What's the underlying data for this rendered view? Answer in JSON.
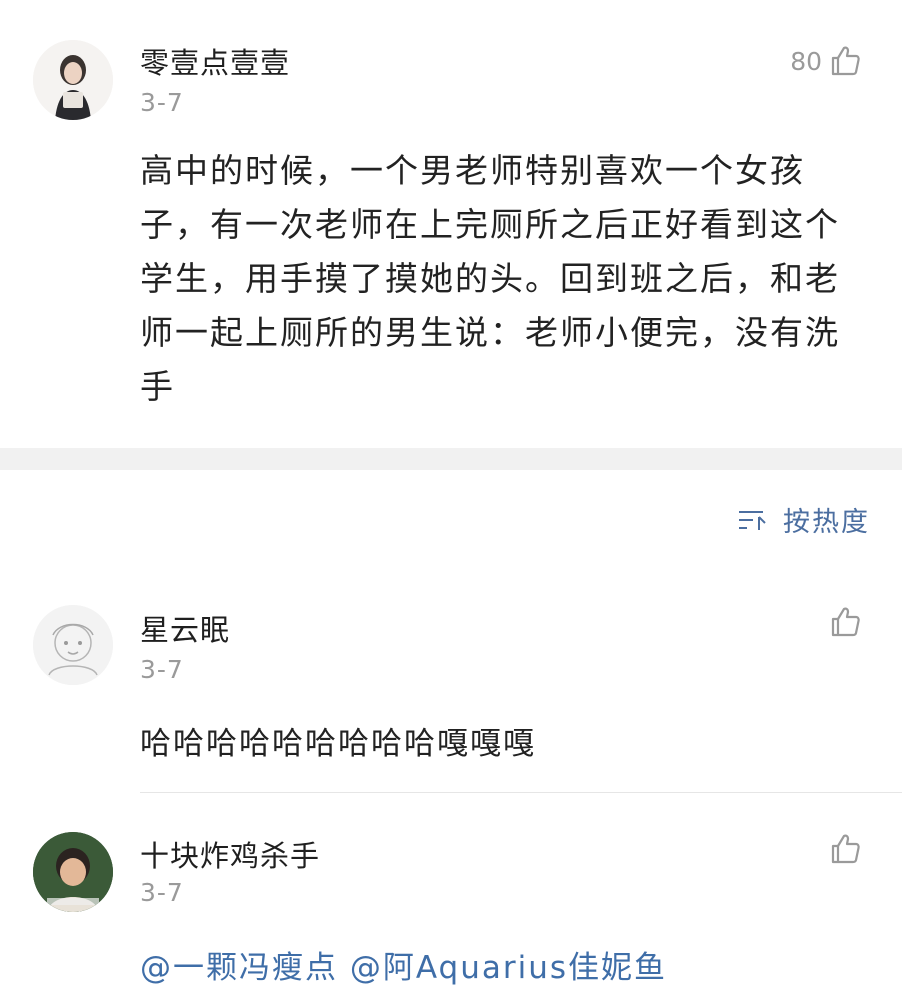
{
  "post": {
    "author": "零壹点壹壹",
    "date": "3-7",
    "likes": "80",
    "body": "高中的时候，一个男老师特别喜欢一个女孩子，有一次老师在上完厕所之后正好看到这个学生，用手摸了摸她的头。回到班之后，和老师一起上厕所的男生说：老师小便完，没有洗手"
  },
  "sort": {
    "label": "按热度",
    "icon": "sort-icon"
  },
  "comments": [
    {
      "author": "星云眠",
      "date": "3-7",
      "text": "哈哈哈哈哈哈哈哈哈嘎嘎嘎"
    },
    {
      "author": "十块炸鸡杀手",
      "date": "3-7",
      "mentions": [
        "@一颗冯瘦点",
        "@阿Aquarius佳妮鱼"
      ]
    }
  ],
  "colors": {
    "mention": "#3f6ea8",
    "sort": "#4b6ea0",
    "meta": "#9a9a9a",
    "divider": "#f1f1f1"
  }
}
